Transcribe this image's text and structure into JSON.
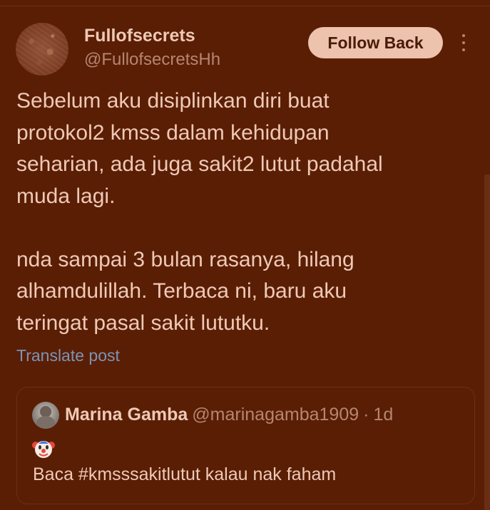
{
  "author": {
    "display_name": "Fullofsecrets",
    "handle": "@FullofsecretsHh"
  },
  "follow_button_label": "Follow Back",
  "more_icon": "more-vertical-icon",
  "post": {
    "text": "Sebelum aku disiplinkan diri buat\nprotokol2 kmss dalam kehidupan\nseharian, ada juga sakit2 lutut padahal\nmuda lagi.\n\nnda sampai 3 bulan rasanya, hilang\nalhamdulillah. Terbaca ni, baru aku\nteringat pasal sakit lututku.",
    "translate_label": "Translate post"
  },
  "quoted_post": {
    "display_name": "Marina Gamba",
    "handle": "@marinagamba1909",
    "separator": "·",
    "time": "1d",
    "emoji": "clown-face-icon",
    "text": "Baca #kmsssakitlutut kalau nak faham"
  },
  "colors": {
    "background": "#5a1e05",
    "text_primary": "#efc9b6",
    "text_secondary": "#b58670",
    "link": "#7d93b3",
    "button_bg": "#edc3ad"
  }
}
